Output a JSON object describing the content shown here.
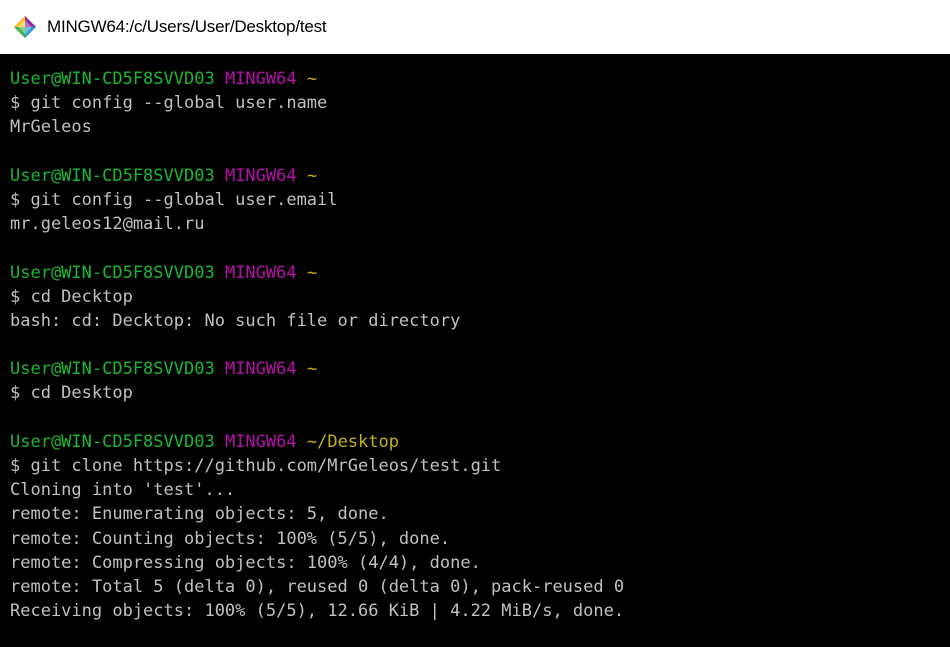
{
  "window": {
    "title": "MINGW64:/c/Users/User/Desktop/test",
    "icon": "git-bash-icon"
  },
  "colors": {
    "background": "#000000",
    "text": "#c0c0c0",
    "prompt_user": "#19b832",
    "prompt_host": "#b60fa7",
    "prompt_path": "#c2b21a"
  },
  "blocks": [
    {
      "prompt": {
        "user": "User@WIN-CD5F8SVVD03",
        "host": "MINGW64",
        "path": "~"
      },
      "command": "$ git config --global user.name",
      "output": [
        "MrGeleos"
      ]
    },
    {
      "prompt": {
        "user": "User@WIN-CD5F8SVVD03",
        "host": "MINGW64",
        "path": "~"
      },
      "command": "$ git config --global user.email",
      "output": [
        "mr.geleos12@mail.ru"
      ]
    },
    {
      "prompt": {
        "user": "User@WIN-CD5F8SVVD03",
        "host": "MINGW64",
        "path": "~"
      },
      "command": "$ cd Decktop",
      "output": [
        "bash: cd: Decktop: No such file or directory"
      ]
    },
    {
      "prompt": {
        "user": "User@WIN-CD5F8SVVD03",
        "host": "MINGW64",
        "path": "~"
      },
      "command": "$ cd Desktop",
      "output": []
    },
    {
      "prompt": {
        "user": "User@WIN-CD5F8SVVD03",
        "host": "MINGW64",
        "path": "~/Desktop"
      },
      "command": "$ git clone https://github.com/MrGeleos/test.git",
      "output": [
        "Cloning into 'test'...",
        "remote: Enumerating objects: 5, done.",
        "remote: Counting objects: 100% (5/5), done.",
        "remote: Compressing objects: 100% (4/4), done.",
        "remote: Total 5 (delta 0), reused 0 (delta 0), pack-reused 0",
        "Receiving objects: 100% (5/5), 12.66 KiB | 4.22 MiB/s, done."
      ]
    }
  ]
}
